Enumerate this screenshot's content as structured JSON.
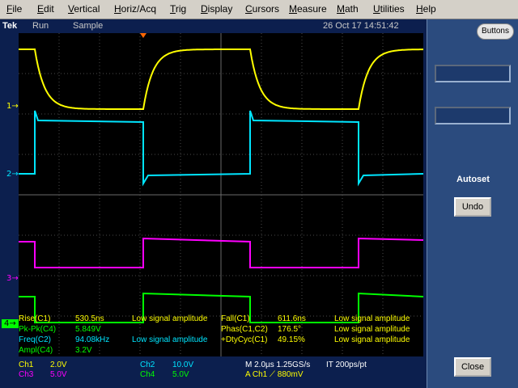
{
  "menu": [
    "File",
    "Edit",
    "Vertical",
    "Horiz/Acq",
    "Trig",
    "Display",
    "Cursors",
    "Measure",
    "Math",
    "Utilities",
    "Help"
  ],
  "status": {
    "brand": "Tek",
    "run_state": "Run",
    "acq_mode": "Sample",
    "timestamp": "26 Oct 17 14:51:42"
  },
  "channel_markers": [
    "1",
    "2",
    "3",
    "4"
  ],
  "colors": {
    "ch1": "#ffff00",
    "ch2": "#00e5ff",
    "ch3": "#ff00ff",
    "ch4": "#00ff00"
  },
  "measurements": {
    "left": [
      {
        "label": "Rise(C1)",
        "value": "530.5ns",
        "status": "Low signal amplitude"
      },
      {
        "label": "Pk-Pk(C4)",
        "value": "5.849V",
        "status": ""
      },
      {
        "label": "Freq(C2)",
        "value": "94.08kHz",
        "status": "Low signal amplitude"
      },
      {
        "label": "Ampl(C4)",
        "value": "3.2V",
        "status": ""
      }
    ],
    "right": [
      {
        "label": "Fall(C1)",
        "value": "611.6ns",
        "status": "Low signal amplitude"
      },
      {
        "label": "Phas(C1,C2)",
        "value": "176.5°",
        "status": "Low signal amplitude"
      },
      {
        "label": "+DtyCyc(C1)",
        "value": "49.15%",
        "status": "Low signal amplitude"
      }
    ]
  },
  "readout": {
    "ch1_label": "Ch1",
    "ch1_scale": "2.0V",
    "ch3_label": "Ch3",
    "ch3_scale": "5.0V",
    "ch2_label": "Ch2",
    "ch2_scale": "10.0V",
    "ch4_label": "Ch4",
    "ch4_scale": "5.0V",
    "timebase": "M 2.0µs 1.25GS/s",
    "interp": "IT 200ps/pt",
    "trigger": "A  Ch1  ⟋  880mV"
  },
  "panel": {
    "buttons_label": "Buttons",
    "autoset_label": "Autoset",
    "undo_label": "Undo",
    "close_label": "Close"
  }
}
